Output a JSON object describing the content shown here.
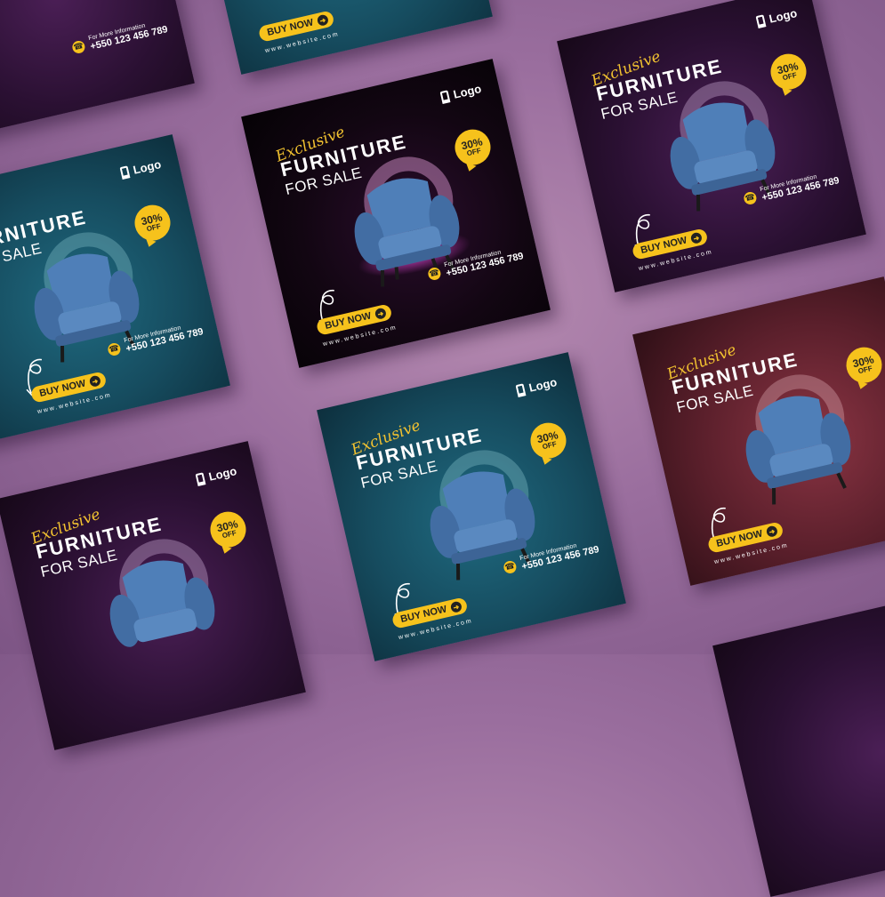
{
  "card": {
    "logo": "Logo",
    "script": "Exclusive",
    "title": "FURNITURE",
    "subtitle": "FOR SALE",
    "badge_pct": "30%",
    "badge_off": "OFF",
    "contact_label": "For More Information",
    "contact_number": "+550 123 456 789",
    "buy_label": "BUY NOW",
    "website": "www.website.com"
  },
  "colors": {
    "accent": "#f6c21c",
    "chair": "#4f7fb8",
    "background": "#9a6e9e"
  },
  "icons": [
    "chair-logo-icon",
    "phone-icon",
    "arrow-right-icon",
    "curly-arrow-icon",
    "armchair-icon"
  ]
}
